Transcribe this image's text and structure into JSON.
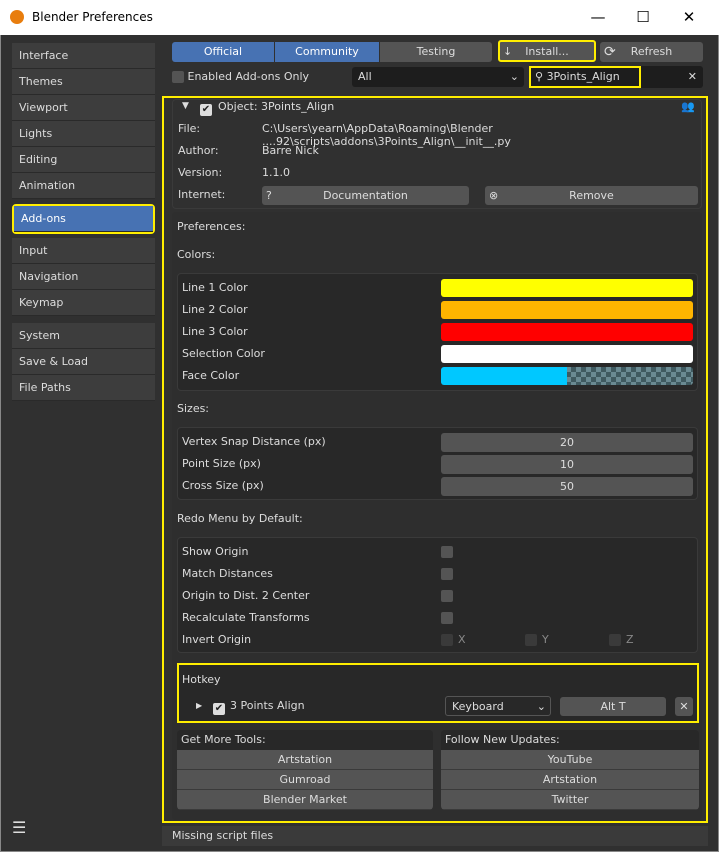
{
  "window": {
    "title": "Blender Preferences",
    "minimize": "—",
    "maximize": "☐",
    "close": "✕"
  },
  "sidebar": {
    "groups": [
      [
        "Interface",
        "Themes",
        "Viewport",
        "Lights",
        "Editing",
        "Animation"
      ],
      [
        "Add-ons"
      ],
      [
        "Input",
        "Navigation",
        "Keymap"
      ],
      [
        "System",
        "Save & Load",
        "File Paths"
      ]
    ],
    "active": "Add-ons",
    "menu_icon": "☰"
  },
  "tabs": [
    {
      "label": "Official",
      "active": true
    },
    {
      "label": "Community",
      "active": true
    },
    {
      "label": "Testing",
      "active": false
    }
  ],
  "install_label": "Install...",
  "refresh_label": "Refresh",
  "filter": {
    "enabled_only_label": "Enabled Add-ons Only",
    "category": "All",
    "search": "3Points_Align"
  },
  "addon": {
    "name": "Object: 3Points_Align",
    "enabled": true,
    "file_label": "File:",
    "file": "C:\\Users\\yearn\\AppData\\Roaming\\Blender ....92\\scripts\\addons\\3Points_Align\\__init__.py",
    "author_label": "Author:",
    "author": "Barre Nick",
    "version_label": "Version:",
    "version": "1.1.0",
    "internet_label": "Internet:",
    "documentation": "Documentation",
    "remove": "Remove"
  },
  "prefs": {
    "title": "Preferences:",
    "colors_title": "Colors:",
    "colors": [
      {
        "label": "Line 1 Color",
        "color": "#ffff00"
      },
      {
        "label": "Line 2 Color",
        "color": "#ffb400"
      },
      {
        "label": "Line 3 Color",
        "color": "#ff0000"
      },
      {
        "label": "Selection Color",
        "color": "#ffffff"
      },
      {
        "label": "Face Color",
        "color": "#00c8ff"
      }
    ],
    "sizes_title": "Sizes:",
    "sizes": [
      {
        "label": "Vertex Snap Distance (px)",
        "value": "20"
      },
      {
        "label": "Point Size (px)",
        "value": "10"
      },
      {
        "label": "Cross Size (px)",
        "value": "50"
      }
    ],
    "redo_title": "Redo Menu by Default:",
    "redo": [
      "Show Origin",
      "Match Distances",
      "Origin to Dist. 2 Center",
      "Recalculate Transforms"
    ],
    "invert_label": "Invert Origin",
    "axes": [
      "X",
      "Y",
      "Z"
    ]
  },
  "hotkey": {
    "title": "Hotkey",
    "name": "3 Points Align",
    "enabled": true,
    "device": "Keyboard",
    "key": "Alt T"
  },
  "tools": {
    "title": "Get More Tools:",
    "links": [
      "Artstation",
      "Gumroad",
      "Blender Market"
    ]
  },
  "updates": {
    "title": "Follow New Updates:",
    "links": [
      "YouTube",
      "Artstation",
      "Twitter"
    ]
  },
  "status": "Missing script files"
}
